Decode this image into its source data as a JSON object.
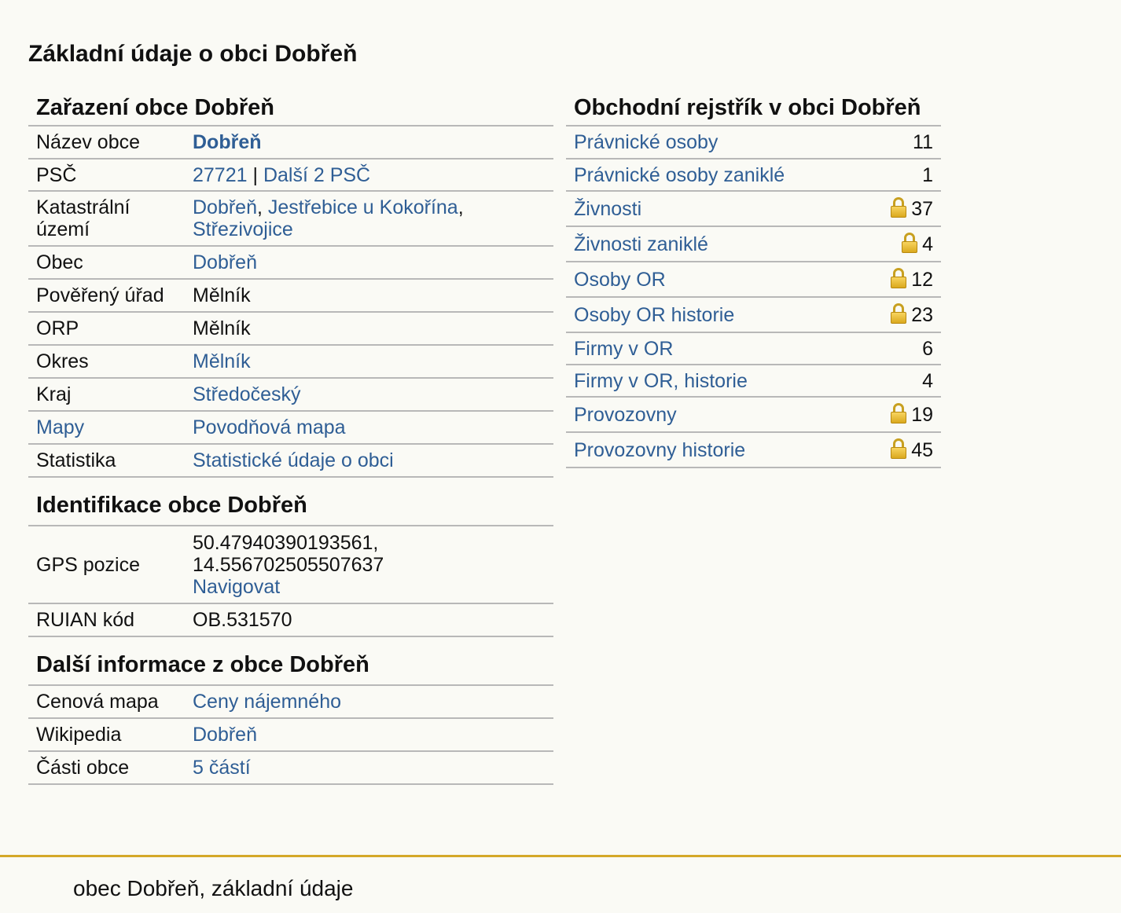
{
  "page_title": "Základní údaje o obci Dobřeň",
  "zarazeni": {
    "title": "Zařazení obce Dobřeň",
    "nazev_obce": {
      "label": "Název obce",
      "value": "Dobřeň"
    },
    "psc": {
      "label": "PSČ",
      "code": "27721",
      "separator": "|",
      "more": "Další 2 PSČ"
    },
    "katastr": {
      "label": "Katastrální území",
      "items": [
        "Dobřeň",
        "Jestřebice u Kokořína",
        "Střezivojice"
      ],
      "sep": ","
    },
    "obec": {
      "label": "Obec",
      "value": "Dobřeň"
    },
    "povereny": {
      "label": "Pověřený úřad",
      "value": "Mělník"
    },
    "orp": {
      "label": "ORP",
      "value": "Mělník"
    },
    "okres": {
      "label": "Okres",
      "value": "Mělník"
    },
    "kraj": {
      "label": "Kraj",
      "value": "Středočeský"
    },
    "mapy": {
      "label": "Mapy",
      "value": "Povodňová mapa"
    },
    "statistika": {
      "label": "Statistika",
      "value": "Statistické údaje o obci"
    }
  },
  "identifikace": {
    "title": "Identifikace obce Dobřeň",
    "gps": {
      "label": "GPS pozice",
      "lat": "50.47940390193561,",
      "lon": "14.556702505507637",
      "navigate": "Navigovat"
    },
    "ruian": {
      "label": "RUIAN kód",
      "value": "OB.531570"
    }
  },
  "dalsi": {
    "title": "Další informace z obce Dobřeň",
    "cenova": {
      "label": "Cenová mapa",
      "value": "Ceny nájemného"
    },
    "wikipedia": {
      "label": "Wikipedia",
      "value": "Dobřeň"
    },
    "casti": {
      "label": "Části obce",
      "value": "5 částí"
    }
  },
  "rejstrik": {
    "title": "Obchodní rejstřík v obci Dobřeň",
    "rows": [
      {
        "label": "Právnické osoby",
        "count": "11",
        "locked": false
      },
      {
        "label": "Právnické osoby zaniklé",
        "count": "1",
        "locked": false
      },
      {
        "label": "Živnosti",
        "count": "37",
        "locked": true
      },
      {
        "label": "Živnosti zaniklé",
        "count": "4",
        "locked": true
      },
      {
        "label": "Osoby OR",
        "count": "12",
        "locked": true
      },
      {
        "label": "Osoby OR historie",
        "count": "23",
        "locked": true
      },
      {
        "label": "Firmy v OR",
        "count": "6",
        "locked": false
      },
      {
        "label": "Firmy v OR, historie",
        "count": "4",
        "locked": false
      },
      {
        "label": "Provozovny",
        "count": "19",
        "locked": true
      },
      {
        "label": "Provozovny historie",
        "count": "45",
        "locked": true
      }
    ]
  },
  "footer": {
    "text": "obec Dobřeň, základní údaje"
  },
  "colors": {
    "link": "#2f5e95",
    "accent": "#d4a829",
    "border": "#b8b8b8",
    "lock": "lock-icon"
  }
}
